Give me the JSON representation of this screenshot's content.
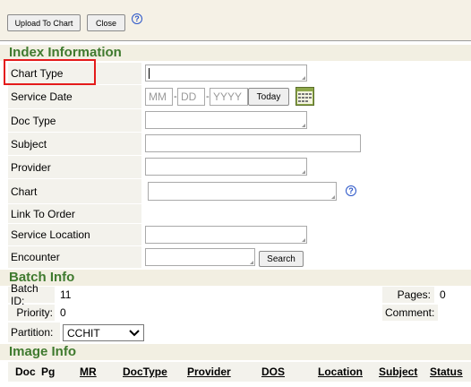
{
  "toolbar": {
    "upload_label": "Upload To Chart",
    "close_label": "Close",
    "help_glyph": "?"
  },
  "index": {
    "heading": "Index Information",
    "fields": {
      "chart_type": "Chart Type",
      "service_date": "Service Date",
      "doc_type": "Doc Type",
      "subject": "Subject",
      "provider": "Provider",
      "chart": "Chart",
      "link_to_order": "Link To Order",
      "service_location": "Service Location",
      "encounter": "Encounter"
    },
    "date_placeholders": {
      "mm": "MM",
      "dd": "DD",
      "yyyy": "YYYY"
    },
    "today_label": "Today",
    "search_label": "Search"
  },
  "batch": {
    "heading": "Batch Info",
    "batch_id_label": "Batch ID:",
    "batch_id_value": "11",
    "pages_label": "Pages:",
    "pages_value": "0",
    "priority_label": "Priority:",
    "priority_value": "0",
    "comment_label": "Comment:",
    "partition_label": "Partition:",
    "partition_value": "CCHIT"
  },
  "image": {
    "heading": "Image Info",
    "columns": [
      "Doc",
      "Pg",
      "MR",
      "DocType",
      "Provider",
      "DOS",
      "Location",
      "Subject",
      "Status"
    ]
  },
  "colors": {
    "heading_green": "#3f7a2e",
    "highlight_red": "#e41b1b",
    "help_blue": "#2a55c8"
  },
  "icons": {
    "calendar": "calendar-icon",
    "help": "help-icon"
  }
}
